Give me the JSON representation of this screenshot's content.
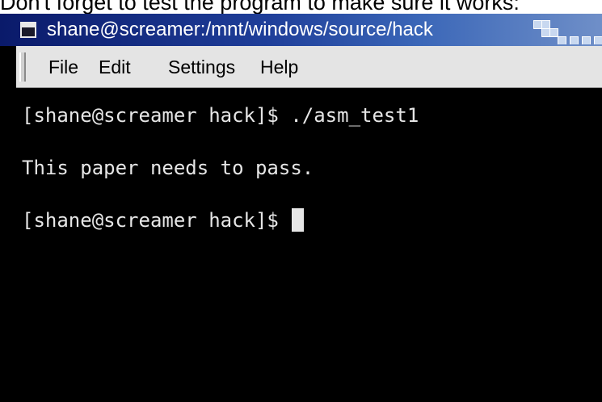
{
  "caption": "Don't forget to test the program to make sure it works:",
  "window": {
    "title": "shane@screamer:/mnt/windows/source/hack",
    "icon": "terminal-window-icon"
  },
  "menu": [
    {
      "label": "File"
    },
    {
      "label": "Edit"
    },
    {
      "label": "Settings"
    },
    {
      "label": "Help"
    }
  ],
  "terminal": {
    "lines": [
      "[shane@screamer hack]$ ./asm_test1",
      "This paper needs to pass.",
      "[shane@screamer hack]$ "
    ],
    "foreground": "#e6e6e6",
    "background": "#000000"
  },
  "colors": {
    "titlebar_start": "#0a1a6a",
    "titlebar_end": "#6f8fc8",
    "menubar": "#e4e4e4"
  }
}
